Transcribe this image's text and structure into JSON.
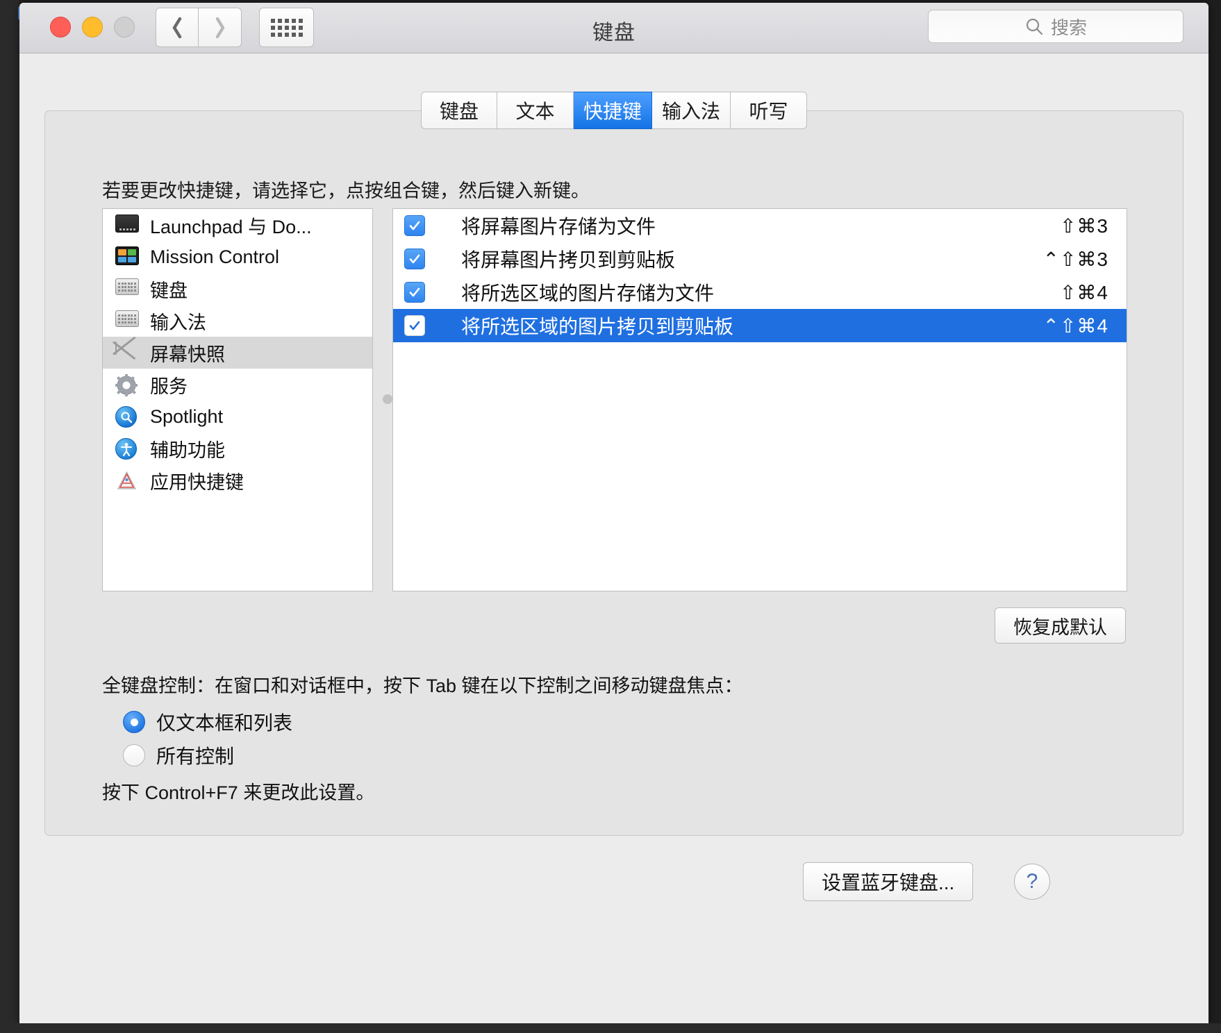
{
  "window": {
    "title": "键盘",
    "traffic_lights": [
      "close",
      "minimize",
      "zoom"
    ],
    "colors": {
      "accent_blue": "#1f6fe0",
      "tab_selected": "#1473e6",
      "checkbox_blue": "#2e84ef",
      "titlebar": "#d6d5d9",
      "panel_bg": "#e4e4e4"
    }
  },
  "toolbar": {
    "back_icon": "chevron-left-icon",
    "forward_icon": "chevron-right-icon",
    "grid_icon": "grid-dots-icon",
    "search": {
      "icon": "search-icon",
      "placeholder": "搜索",
      "value": ""
    }
  },
  "tabs": [
    {
      "label": "键盘",
      "selected": false
    },
    {
      "label": "文本",
      "selected": false
    },
    {
      "label": "快捷键",
      "selected": true
    },
    {
      "label": "输入法",
      "selected": false
    },
    {
      "label": "听写",
      "selected": false
    }
  ],
  "hint": "若要更改快捷键，请选择它，点按组合键，然后键入新键。",
  "sidebar": {
    "items": [
      {
        "label": "Launchpad 与 Do...",
        "icon": "launchpad-dock-icon",
        "selected": false
      },
      {
        "label": "Mission Control",
        "icon": "mission-control-icon",
        "selected": false
      },
      {
        "label": "键盘",
        "icon": "keyboard-icon",
        "selected": false
      },
      {
        "label": "输入法",
        "icon": "input-sources-icon",
        "selected": false
      },
      {
        "label": "屏幕快照",
        "icon": "screenshot-icon",
        "selected": true
      },
      {
        "label": "服务",
        "icon": "gear-icon",
        "selected": false
      },
      {
        "label": "Spotlight",
        "icon": "spotlight-icon",
        "selected": false
      },
      {
        "label": "辅助功能",
        "icon": "accessibility-icon",
        "selected": false
      },
      {
        "label": "应用快捷键",
        "icon": "app-shortcuts-icon",
        "selected": false
      }
    ]
  },
  "shortcuts": {
    "rows": [
      {
        "checked": true,
        "label": "将屏幕图片存储为文件",
        "keys": "⇧⌘3",
        "selected": false
      },
      {
        "checked": true,
        "label": "将屏幕图片拷贝到剪贴板",
        "keys": "⌃⇧⌘3",
        "selected": false
      },
      {
        "checked": true,
        "label": "将所选区域的图片存储为文件",
        "keys": "⇧⌘4",
        "selected": false
      },
      {
        "checked": true,
        "label": "将所选区域的图片拷贝到剪贴板",
        "keys": "⌃⇧⌘4",
        "selected": true
      }
    ]
  },
  "restore_defaults_label": "恢复成默认",
  "full_keyboard_access": {
    "description": "全键盘控制：在窗口和对话框中，按下 Tab 键在以下控制之间移动键盘焦点：",
    "options": [
      {
        "label": "仅文本框和列表",
        "selected": true
      },
      {
        "label": "所有控制",
        "selected": false
      }
    ],
    "note": "按下 Control+F7 来更改此设置。"
  },
  "footer": {
    "bluetooth_button_label": "设置蓝牙键盘...",
    "help_label": "?"
  }
}
